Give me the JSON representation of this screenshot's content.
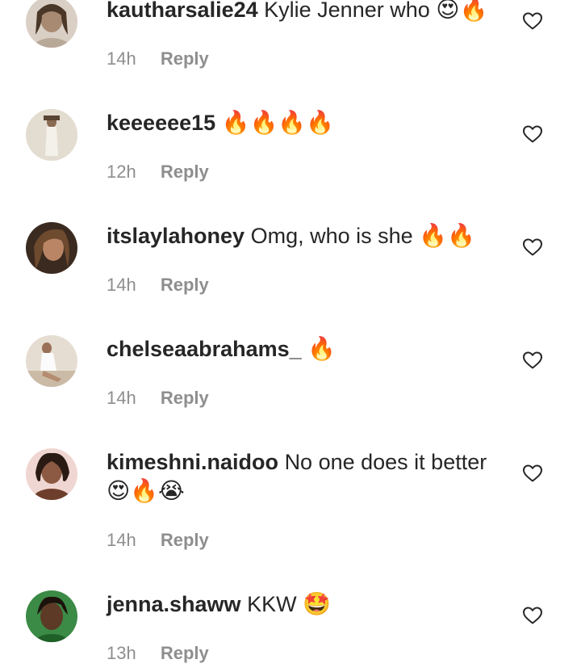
{
  "comments": [
    {
      "username": "kautharsalie24",
      "text": "Kylie Jenner who",
      "emojis": "😍🔥",
      "time": "14h",
      "reply": "Reply",
      "avatar_color": "#c9b8a6"
    },
    {
      "username": "keeeeee15",
      "text": "",
      "emojis": "🔥🔥🔥🔥",
      "time": "12h",
      "reply": "Reply",
      "avatar_color": "#d8cfc0"
    },
    {
      "username": "itslaylahoney",
      "text": "Omg, who is she",
      "emojis": "🔥🔥",
      "time": "14h",
      "reply": "Reply",
      "avatar_color": "#6b4a36"
    },
    {
      "username": "chelseaabrahams_",
      "text": "",
      "emojis": "🔥",
      "time": "14h",
      "reply": "Reply",
      "avatar_color": "#cfc4b6"
    },
    {
      "username": "kimeshni.naidoo",
      "text": "No one does it better",
      "emojis": "😍🔥😭",
      "time": "14h",
      "reply": "Reply",
      "avatar_color": "#5a3b2d"
    },
    {
      "username": "jenna.shaww",
      "text": "KKW",
      "emojis": "🤩",
      "time": "13h",
      "reply": "Reply",
      "avatar_color": "#2e7d32"
    }
  ],
  "icons": {
    "like": "heart-outline-icon"
  },
  "colors": {
    "primary_text": "#262626",
    "secondary_text": "#8e8e8e",
    "background": "#ffffff"
  }
}
